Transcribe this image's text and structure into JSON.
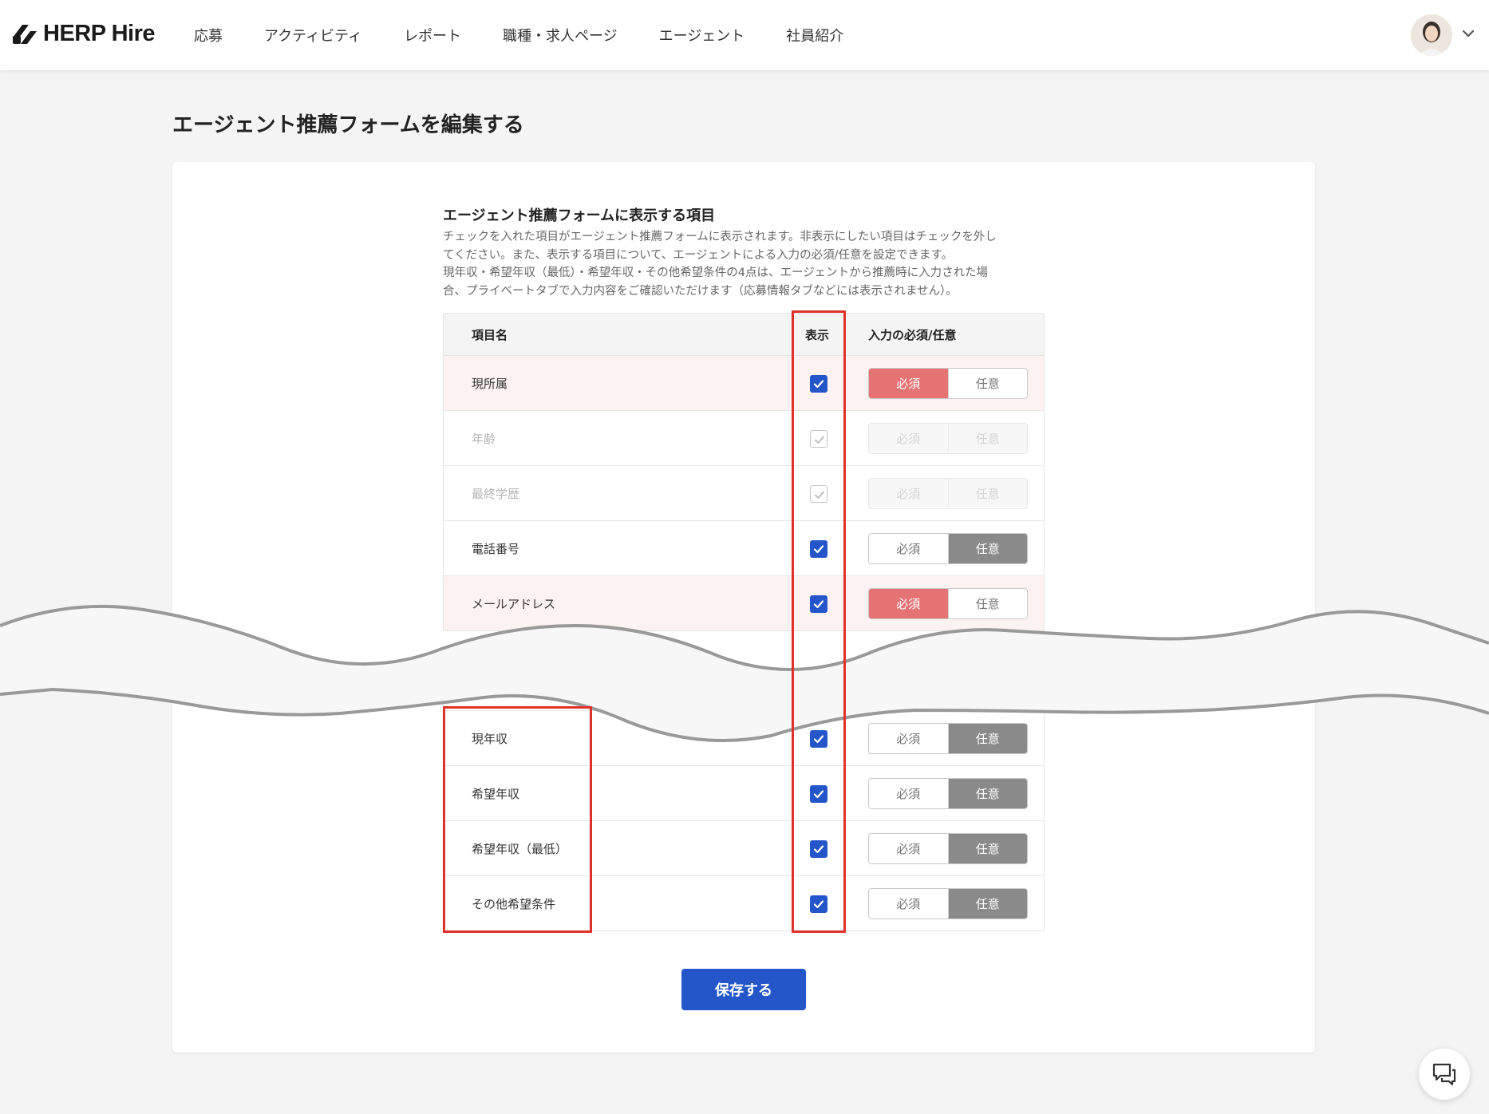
{
  "header": {
    "logo_text": "HERP Hire",
    "nav": [
      "応募",
      "アクティビティ",
      "レポート",
      "職種・求人ページ",
      "エージェント",
      "社員紹介"
    ]
  },
  "page": {
    "title": "エージェント推薦フォームを編集する"
  },
  "section": {
    "title": "エージェント推薦フォームに表示する項目",
    "desc_lines": [
      "チェックを入れた項目がエージェント推薦フォームに表示されます。非表示にしたい項目はチェックを外し",
      "てください。また、表示する項目について、エージェントによる入力の必須/任意を設定できます。",
      "現年収・希望年収（最低）・希望年収・その他希望条件の4点は、エージェントから推薦時に入力された場",
      "合、プライベートタブで入力内容をご確認いただけます（応募情報タブなどには表示されません）。"
    ]
  },
  "table": {
    "headers": {
      "name": "項目名",
      "display": "表示",
      "requirement": "入力の必須/任意"
    },
    "required_label": "必須",
    "optional_label": "任意",
    "rows_top": [
      {
        "label": "現所属",
        "checked": true,
        "disabled": false,
        "mode": "required"
      },
      {
        "label": "年齢",
        "checked": true,
        "disabled": true,
        "mode": "none"
      },
      {
        "label": "最終学歴",
        "checked": true,
        "disabled": true,
        "mode": "none"
      },
      {
        "label": "電話番号",
        "checked": true,
        "disabled": false,
        "mode": "optional"
      },
      {
        "label": "メールアドレス",
        "checked": true,
        "disabled": false,
        "mode": "required"
      }
    ],
    "rows_bottom": [
      {
        "label": "現年収",
        "checked": true,
        "disabled": false,
        "mode": "optional"
      },
      {
        "label": "希望年収",
        "checked": true,
        "disabled": false,
        "mode": "optional"
      },
      {
        "label": "希望年収（最低）",
        "checked": true,
        "disabled": false,
        "mode": "optional"
      },
      {
        "label": "その他希望条件",
        "checked": true,
        "disabled": false,
        "mode": "optional"
      }
    ]
  },
  "actions": {
    "save_label": "保存する"
  },
  "colors": {
    "primary": "#2456c9",
    "required_active": "#e57373",
    "optional_active": "#8a8a8a",
    "highlight": "#e0302a",
    "required_row_bg": "#fdf2f2"
  },
  "icons": {
    "logo": "herp-logo-icon",
    "avatar": "user-avatar",
    "chevron": "chevron-down-icon",
    "chat": "chat-bubbles-icon"
  }
}
